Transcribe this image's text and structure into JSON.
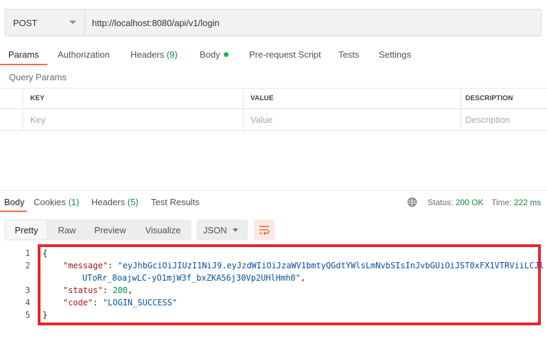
{
  "request": {
    "method": "POST",
    "url": "http://localhost:8080/api/v1/login"
  },
  "request_tabs": [
    {
      "label": "Params",
      "count": ""
    },
    {
      "label": "Authorization",
      "count": ""
    },
    {
      "label": "Headers",
      "count": "(9)"
    },
    {
      "label": "Body",
      "count": ""
    },
    {
      "label": "Pre-request Script",
      "count": ""
    },
    {
      "label": "Tests",
      "count": ""
    },
    {
      "label": "Settings",
      "count": ""
    }
  ],
  "query_params": {
    "title": "Query Params",
    "columns": [
      "KEY",
      "VALUE",
      "DESCRIPTION"
    ],
    "placeholders": [
      "Key",
      "Value",
      "Description"
    ]
  },
  "response_tabs": [
    {
      "label": "Body",
      "count": ""
    },
    {
      "label": "Cookies",
      "count": "(1)"
    },
    {
      "label": "Headers",
      "count": "(5)"
    },
    {
      "label": "Test Results",
      "count": ""
    }
  ],
  "response_meta": {
    "status_label": "Status:",
    "status_value": "200 OK",
    "time_label": "Time:",
    "time_value": "222 ms"
  },
  "view_modes": [
    "Pretty",
    "Raw",
    "Preview",
    "Visualize"
  ],
  "format": "JSON",
  "code": {
    "line_numbers": [
      "1",
      "2",
      "3",
      "4",
      "5"
    ],
    "open_brace": "{",
    "close_brace": "}",
    "message_key": "\"message\"",
    "message_value_1": "\"eyJhbGciOiJIUzI1NiJ9.eyJzdWIiOiJzaWV1bmtyQGdtYWlsLmNvbSIsInJvbGUiOiJST0xFX1VTRViiLCJle",
    "message_value_2": "UToRr_8oajwLC-yO1mjW3f_bxZKA56j30Vp2UHlHmh0\"",
    "status_key": "\"status\"",
    "status_value": "200",
    "code_key": "\"code\"",
    "code_value": "\"LOGIN_SUCCESS\""
  },
  "colors": {
    "accent": "#f26b3a",
    "success": "#0c8a3c",
    "highlight_box": "#e8232a"
  }
}
